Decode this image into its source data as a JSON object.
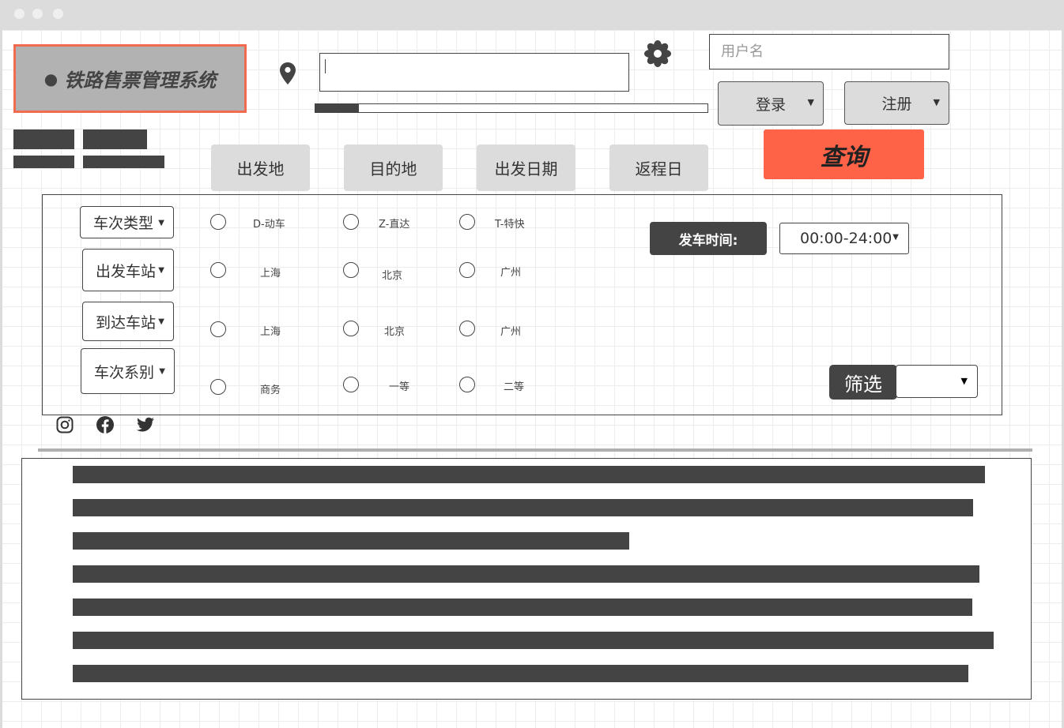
{
  "header": {
    "app_title": "铁路售票管理系统",
    "search": {
      "value": "",
      "placeholder": ""
    },
    "progress_fraction": 0.11,
    "username_placeholder": "用户名",
    "login_label": "登录",
    "register_label": "注册",
    "query_label": "查询"
  },
  "tabs": [
    {
      "label": "出发地"
    },
    {
      "label": "目的地"
    },
    {
      "label": "出发日期"
    },
    {
      "label": "返程日"
    }
  ],
  "filters": {
    "rows": [
      {
        "label": "车次类型",
        "options": [
          "D-动车",
          "Z-直达",
          "T-特快"
        ]
      },
      {
        "label": "出发车站",
        "options": [
          "上海",
          "北京",
          "广州"
        ]
      },
      {
        "label": "到达车站",
        "options": [
          "上海",
          "北京",
          "广州"
        ]
      },
      {
        "label": "车次系别",
        "options": [
          "商务",
          "一等",
          "二等"
        ]
      }
    ],
    "departure_time_label": "发车时间:",
    "departure_time_value": "00:00-24:00",
    "filter_label": "筛选",
    "filter_value": ""
  },
  "social": [
    "instagram-icon",
    "facebook-icon",
    "twitter-icon"
  ],
  "colors": {
    "accent": "#ff6347",
    "logo_border": "#f26a4f",
    "logo_bg": "#b2b2b2",
    "dark": "#444444",
    "button_bg": "#dcdcdc"
  }
}
